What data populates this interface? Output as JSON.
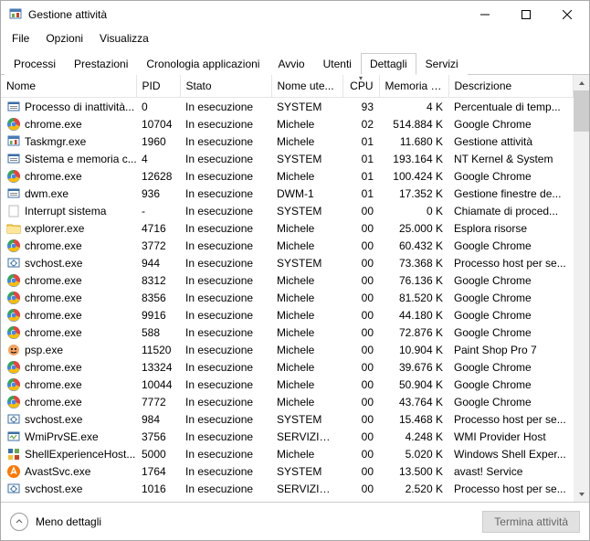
{
  "title": "Gestione attività",
  "menu": {
    "file": "File",
    "options": "Opzioni",
    "view": "Visualizza"
  },
  "tabs": {
    "processes": "Processi",
    "performance": "Prestazioni",
    "app_history": "Cronologia applicazioni",
    "startup": "Avvio",
    "users": "Utenti",
    "details": "Dettagli",
    "services": "Servizi"
  },
  "columns": {
    "name": "Nome",
    "pid": "PID",
    "status": "Stato",
    "username": "Nome ute...",
    "cpu": "CPU",
    "memory": "Memoria (...",
    "description": "Descrizione"
  },
  "footer": {
    "less_details": "Meno dettagli",
    "end_task": "Termina attività"
  },
  "icons": {
    "system": "system",
    "chrome": "chrome",
    "taskmgr": "taskmgr",
    "blank": "blank",
    "explorer": "explorer",
    "svchost": "svchost",
    "psp": "psp",
    "wmi": "wmi",
    "shell": "shell",
    "avast": "avast",
    "dwm": "system"
  },
  "rows": [
    {
      "icon": "system",
      "name": "Processo di inattività...",
      "pid": "0",
      "status": "In esecuzione",
      "user": "SYSTEM",
      "cpu": "93",
      "mem": "4 K",
      "desc": "Percentuale di temp..."
    },
    {
      "icon": "chrome",
      "name": "chrome.exe",
      "pid": "10704",
      "status": "In esecuzione",
      "user": "Michele",
      "cpu": "02",
      "mem": "514.884 K",
      "desc": "Google Chrome"
    },
    {
      "icon": "taskmgr",
      "name": "Taskmgr.exe",
      "pid": "1960",
      "status": "In esecuzione",
      "user": "Michele",
      "cpu": "01",
      "mem": "11.680 K",
      "desc": "Gestione attività"
    },
    {
      "icon": "system",
      "name": "Sistema e memoria c...",
      "pid": "4",
      "status": "In esecuzione",
      "user": "SYSTEM",
      "cpu": "01",
      "mem": "193.164 K",
      "desc": "NT Kernel & System"
    },
    {
      "icon": "chrome",
      "name": "chrome.exe",
      "pid": "12628",
      "status": "In esecuzione",
      "user": "Michele",
      "cpu": "01",
      "mem": "100.424 K",
      "desc": "Google Chrome"
    },
    {
      "icon": "system",
      "name": "dwm.exe",
      "pid": "936",
      "status": "In esecuzione",
      "user": "DWM-1",
      "cpu": "01",
      "mem": "17.352 K",
      "desc": "Gestione finestre de..."
    },
    {
      "icon": "blank",
      "name": "Interrupt sistema",
      "pid": "-",
      "status": "In esecuzione",
      "user": "SYSTEM",
      "cpu": "00",
      "mem": "0 K",
      "desc": "Chiamate di proced..."
    },
    {
      "icon": "explorer",
      "name": "explorer.exe",
      "pid": "4716",
      "status": "In esecuzione",
      "user": "Michele",
      "cpu": "00",
      "mem": "25.000 K",
      "desc": "Esplora risorse"
    },
    {
      "icon": "chrome",
      "name": "chrome.exe",
      "pid": "3772",
      "status": "In esecuzione",
      "user": "Michele",
      "cpu": "00",
      "mem": "60.432 K",
      "desc": "Google Chrome"
    },
    {
      "icon": "svchost",
      "name": "svchost.exe",
      "pid": "944",
      "status": "In esecuzione",
      "user": "SYSTEM",
      "cpu": "00",
      "mem": "73.368 K",
      "desc": "Processo host per se..."
    },
    {
      "icon": "chrome",
      "name": "chrome.exe",
      "pid": "8312",
      "status": "In esecuzione",
      "user": "Michele",
      "cpu": "00",
      "mem": "76.136 K",
      "desc": "Google Chrome"
    },
    {
      "icon": "chrome",
      "name": "chrome.exe",
      "pid": "8356",
      "status": "In esecuzione",
      "user": "Michele",
      "cpu": "00",
      "mem": "81.520 K",
      "desc": "Google Chrome"
    },
    {
      "icon": "chrome",
      "name": "chrome.exe",
      "pid": "9916",
      "status": "In esecuzione",
      "user": "Michele",
      "cpu": "00",
      "mem": "44.180 K",
      "desc": "Google Chrome"
    },
    {
      "icon": "chrome",
      "name": "chrome.exe",
      "pid": "588",
      "status": "In esecuzione",
      "user": "Michele",
      "cpu": "00",
      "mem": "72.876 K",
      "desc": "Google Chrome"
    },
    {
      "icon": "psp",
      "name": "psp.exe",
      "pid": "11520",
      "status": "In esecuzione",
      "user": "Michele",
      "cpu": "00",
      "mem": "10.904 K",
      "desc": "Paint Shop Pro 7"
    },
    {
      "icon": "chrome",
      "name": "chrome.exe",
      "pid": "13324",
      "status": "In esecuzione",
      "user": "Michele",
      "cpu": "00",
      "mem": "39.676 K",
      "desc": "Google Chrome"
    },
    {
      "icon": "chrome",
      "name": "chrome.exe",
      "pid": "10044",
      "status": "In esecuzione",
      "user": "Michele",
      "cpu": "00",
      "mem": "50.904 K",
      "desc": "Google Chrome"
    },
    {
      "icon": "chrome",
      "name": "chrome.exe",
      "pid": "7772",
      "status": "In esecuzione",
      "user": "Michele",
      "cpu": "00",
      "mem": "43.764 K",
      "desc": "Google Chrome"
    },
    {
      "icon": "svchost",
      "name": "svchost.exe",
      "pid": "984",
      "status": "In esecuzione",
      "user": "SYSTEM",
      "cpu": "00",
      "mem": "15.468 K",
      "desc": "Processo host per se..."
    },
    {
      "icon": "wmi",
      "name": "WmiPrvSE.exe",
      "pid": "3756",
      "status": "In esecuzione",
      "user": "SERVIZIO ...",
      "cpu": "00",
      "mem": "4.248 K",
      "desc": "WMI Provider Host"
    },
    {
      "icon": "shell",
      "name": "ShellExperienceHost....",
      "pid": "5000",
      "status": "In esecuzione",
      "user": "Michele",
      "cpu": "00",
      "mem": "5.020 K",
      "desc": "Windows Shell Exper..."
    },
    {
      "icon": "avast",
      "name": "AvastSvc.exe",
      "pid": "1764",
      "status": "In esecuzione",
      "user": "SYSTEM",
      "cpu": "00",
      "mem": "13.500 K",
      "desc": "avast! Service"
    },
    {
      "icon": "svchost",
      "name": "svchost.exe",
      "pid": "1016",
      "status": "In esecuzione",
      "user": "SERVIZIO L...",
      "cpu": "00",
      "mem": "2.520 K",
      "desc": "Processo host per se..."
    }
  ]
}
